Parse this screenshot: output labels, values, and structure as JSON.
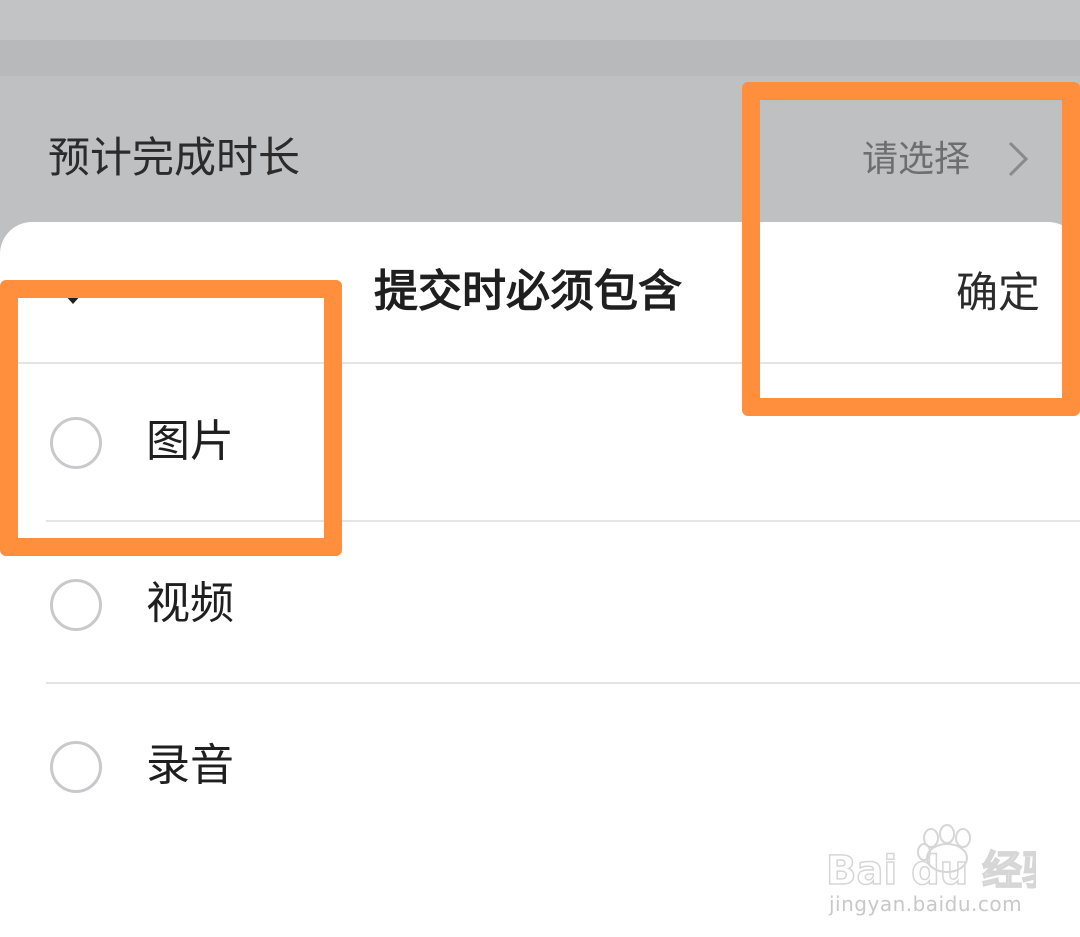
{
  "setting": {
    "label": "预计完成时长",
    "value": "请选择"
  },
  "sheet": {
    "title": "提交时必须包含",
    "confirm_label": "确定",
    "options": [
      {
        "label": "图片",
        "checked": false
      },
      {
        "label": "视频",
        "checked": false
      },
      {
        "label": "录音",
        "checked": false
      }
    ]
  },
  "watermark": {
    "brand": "Bai du 经验",
    "url": "jingyan.baidu.com"
  },
  "colors": {
    "highlight": "#ff8f3d",
    "overlay": "#bfc0c2",
    "sheet": "#ffffff"
  },
  "icons": [
    "chevron-right-icon",
    "caret-down-icon",
    "radio-icon",
    "baidu-paw-icon"
  ]
}
